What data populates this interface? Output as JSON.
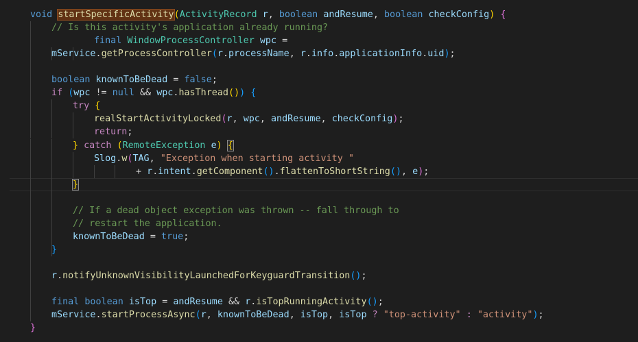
{
  "editor": {
    "lines": [
      {
        "tokens": [
          {
            "t": "void",
            "c": "kw"
          },
          {
            "t": " ",
            "c": "op"
          },
          {
            "t": "startSpecificActivity",
            "c": "fn",
            "x": "hl-word"
          },
          {
            "t": "(",
            "c": "b1"
          },
          {
            "t": "ActivityRecord",
            "c": "type"
          },
          {
            "t": " ",
            "c": "op"
          },
          {
            "t": "r",
            "c": "var"
          },
          {
            "t": ", ",
            "c": "op"
          },
          {
            "t": "boolean",
            "c": "kw"
          },
          {
            "t": " ",
            "c": "op"
          },
          {
            "t": "andResume",
            "c": "var"
          },
          {
            "t": ", ",
            "c": "op"
          },
          {
            "t": "boolean",
            "c": "kw"
          },
          {
            "t": " ",
            "c": "op"
          },
          {
            "t": "checkConfig",
            "c": "var"
          },
          {
            "t": ")",
            "c": "b1"
          },
          {
            "t": " ",
            "c": "op"
          },
          {
            "t": "{",
            "c": "b2"
          }
        ]
      },
      {
        "tokens": [
          {
            "t": "// Is this activity's application already running?",
            "c": "cm"
          }
        ]
      },
      {
        "tokens": [
          {
            "t": "final",
            "c": "kw"
          },
          {
            "t": " ",
            "c": "op"
          },
          {
            "t": "WindowProcessController",
            "c": "type"
          },
          {
            "t": " ",
            "c": "op"
          },
          {
            "t": "wpc",
            "c": "var"
          },
          {
            "t": " =",
            "c": "op"
          }
        ]
      },
      {
        "tokens": [
          {
            "t": "mService",
            "c": "var"
          },
          {
            "t": ".",
            "c": "op"
          },
          {
            "t": "getProcessController",
            "c": "fn"
          },
          {
            "t": "(",
            "c": "b3"
          },
          {
            "t": "r",
            "c": "var"
          },
          {
            "t": ".",
            "c": "op"
          },
          {
            "t": "processName",
            "c": "var"
          },
          {
            "t": ", ",
            "c": "op"
          },
          {
            "t": "r",
            "c": "var"
          },
          {
            "t": ".",
            "c": "op"
          },
          {
            "t": "info",
            "c": "var"
          },
          {
            "t": ".",
            "c": "op"
          },
          {
            "t": "applicationInfo",
            "c": "var"
          },
          {
            "t": ".",
            "c": "op"
          },
          {
            "t": "uid",
            "c": "var"
          },
          {
            "t": ")",
            "c": "b3"
          },
          {
            "t": ";",
            "c": "op"
          }
        ]
      },
      {
        "tokens": []
      },
      {
        "tokens": [
          {
            "t": "boolean",
            "c": "kw"
          },
          {
            "t": " ",
            "c": "op"
          },
          {
            "t": "knownToBeDead",
            "c": "var"
          },
          {
            "t": " = ",
            "c": "op"
          },
          {
            "t": "false",
            "c": "kw"
          },
          {
            "t": ";",
            "c": "op"
          }
        ]
      },
      {
        "tokens": [
          {
            "t": "if",
            "c": "ctl"
          },
          {
            "t": " ",
            "c": "op"
          },
          {
            "t": "(",
            "c": "b3"
          },
          {
            "t": "wpc",
            "c": "var"
          },
          {
            "t": " != ",
            "c": "op"
          },
          {
            "t": "null",
            "c": "kw"
          },
          {
            "t": " && ",
            "c": "op"
          },
          {
            "t": "wpc",
            "c": "var"
          },
          {
            "t": ".",
            "c": "op"
          },
          {
            "t": "hasThread",
            "c": "fn"
          },
          {
            "t": "(",
            "c": "b1"
          },
          {
            "t": ")",
            "c": "b1"
          },
          {
            "t": ")",
            "c": "b3"
          },
          {
            "t": " ",
            "c": "op"
          },
          {
            "t": "{",
            "c": "b3"
          }
        ]
      },
      {
        "tokens": [
          {
            "t": "try",
            "c": "ctl"
          },
          {
            "t": " ",
            "c": "op"
          },
          {
            "t": "{",
            "c": "b1"
          }
        ]
      },
      {
        "tokens": [
          {
            "t": "realStartActivityLocked",
            "c": "fn"
          },
          {
            "t": "(",
            "c": "b2"
          },
          {
            "t": "r",
            "c": "var"
          },
          {
            "t": ", ",
            "c": "op"
          },
          {
            "t": "wpc",
            "c": "var"
          },
          {
            "t": ", ",
            "c": "op"
          },
          {
            "t": "andResume",
            "c": "var"
          },
          {
            "t": ", ",
            "c": "op"
          },
          {
            "t": "checkConfig",
            "c": "var"
          },
          {
            "t": ")",
            "c": "b2"
          },
          {
            "t": ";",
            "c": "op"
          }
        ]
      },
      {
        "tokens": [
          {
            "t": "return",
            "c": "ctl"
          },
          {
            "t": ";",
            "c": "op"
          }
        ]
      },
      {
        "tokens": [
          {
            "t": "}",
            "c": "b1"
          },
          {
            "t": " ",
            "c": "op"
          },
          {
            "t": "catch",
            "c": "ctl"
          },
          {
            "t": " ",
            "c": "op"
          },
          {
            "t": "(",
            "c": "b1"
          },
          {
            "t": "RemoteException",
            "c": "type"
          },
          {
            "t": " ",
            "c": "op"
          },
          {
            "t": "e",
            "c": "var"
          },
          {
            "t": ")",
            "c": "b1"
          },
          {
            "t": " ",
            "c": "op"
          },
          {
            "t": "{",
            "c": "b1",
            "x": "bmatch"
          }
        ]
      },
      {
        "tokens": [
          {
            "t": "Slog",
            "c": "var"
          },
          {
            "t": ".",
            "c": "op"
          },
          {
            "t": "w",
            "c": "fn"
          },
          {
            "t": "(",
            "c": "b2"
          },
          {
            "t": "TAG",
            "c": "var"
          },
          {
            "t": ", ",
            "c": "op"
          },
          {
            "t": "\"Exception when starting activity \"",
            "c": "str"
          }
        ]
      },
      {
        "tokens": [
          {
            "t": "+ ",
            "c": "op"
          },
          {
            "t": "r",
            "c": "var"
          },
          {
            "t": ".",
            "c": "op"
          },
          {
            "t": "intent",
            "c": "var"
          },
          {
            "t": ".",
            "c": "op"
          },
          {
            "t": "getComponent",
            "c": "fn"
          },
          {
            "t": "(",
            "c": "b3"
          },
          {
            "t": ")",
            "c": "b3"
          },
          {
            "t": ".",
            "c": "op"
          },
          {
            "t": "flattenToShortString",
            "c": "fn"
          },
          {
            "t": "(",
            "c": "b3"
          },
          {
            "t": ")",
            "c": "b3"
          },
          {
            "t": ", ",
            "c": "op"
          },
          {
            "t": "e",
            "c": "var"
          },
          {
            "t": ")",
            "c": "b2"
          },
          {
            "t": ";",
            "c": "op"
          }
        ]
      },
      {
        "tokens": [
          {
            "t": "}",
            "c": "b1",
            "x": "bmatch"
          }
        ]
      },
      {
        "tokens": []
      },
      {
        "tokens": [
          {
            "t": "// If a dead object exception was thrown -- fall through to",
            "c": "cm"
          }
        ]
      },
      {
        "tokens": [
          {
            "t": "// restart the application.",
            "c": "cm"
          }
        ]
      },
      {
        "tokens": [
          {
            "t": "knownToBeDead",
            "c": "var"
          },
          {
            "t": " = ",
            "c": "op"
          },
          {
            "t": "true",
            "c": "kw"
          },
          {
            "t": ";",
            "c": "op"
          }
        ]
      },
      {
        "tokens": [
          {
            "t": "}",
            "c": "b3"
          }
        ]
      },
      {
        "tokens": []
      },
      {
        "tokens": [
          {
            "t": "r",
            "c": "var"
          },
          {
            "t": ".",
            "c": "op"
          },
          {
            "t": "notifyUnknownVisibilityLaunchedForKeyguardTransition",
            "c": "fn"
          },
          {
            "t": "(",
            "c": "b3"
          },
          {
            "t": ")",
            "c": "b3"
          },
          {
            "t": ";",
            "c": "op"
          }
        ]
      },
      {
        "tokens": []
      },
      {
        "tokens": [
          {
            "t": "final",
            "c": "kw"
          },
          {
            "t": " ",
            "c": "op"
          },
          {
            "t": "boolean",
            "c": "kw"
          },
          {
            "t": " ",
            "c": "op"
          },
          {
            "t": "isTop",
            "c": "var"
          },
          {
            "t": " = ",
            "c": "op"
          },
          {
            "t": "andResume",
            "c": "var"
          },
          {
            "t": " && ",
            "c": "op"
          },
          {
            "t": "r",
            "c": "var"
          },
          {
            "t": ".",
            "c": "op"
          },
          {
            "t": "isTopRunningActivity",
            "c": "fn"
          },
          {
            "t": "(",
            "c": "b3"
          },
          {
            "t": ")",
            "c": "b3"
          },
          {
            "t": ";",
            "c": "op"
          }
        ]
      },
      {
        "tokens": [
          {
            "t": "mService",
            "c": "var"
          },
          {
            "t": ".",
            "c": "op"
          },
          {
            "t": "startProcessAsync",
            "c": "fn"
          },
          {
            "t": "(",
            "c": "b3"
          },
          {
            "t": "r",
            "c": "var"
          },
          {
            "t": ", ",
            "c": "op"
          },
          {
            "t": "knownToBeDead",
            "c": "var"
          },
          {
            "t": ", ",
            "c": "op"
          },
          {
            "t": "isTop",
            "c": "var"
          },
          {
            "t": ", ",
            "c": "op"
          },
          {
            "t": "isTop",
            "c": "var"
          },
          {
            "t": " ",
            "c": "op"
          },
          {
            "t": "?",
            "c": "ctl"
          },
          {
            "t": " ",
            "c": "op"
          },
          {
            "t": "\"top-activity\"",
            "c": "str"
          },
          {
            "t": " ",
            "c": "op"
          },
          {
            "t": ":",
            "c": "ctl"
          },
          {
            "t": " ",
            "c": "op"
          },
          {
            "t": "\"activity\"",
            "c": "str"
          },
          {
            "t": ")",
            "c": "b3"
          },
          {
            "t": ";",
            "c": "op"
          }
        ]
      },
      {
        "tokens": [
          {
            "t": "}",
            "c": "b2"
          }
        ]
      }
    ]
  }
}
